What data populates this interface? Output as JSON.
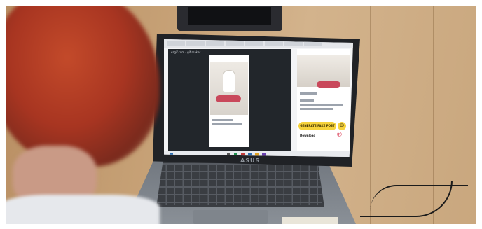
{
  "photo": {
    "description_free": true
  },
  "screen": {
    "viewer_title": "ezgif.com - gif maker",
    "generate_button": "GENERATE FAKE POST",
    "download_label": "Download"
  },
  "laptop": {
    "brand_logo": "ASUS"
  },
  "colors": {
    "hair": "#a83521",
    "button_yellow": "#f6d23b",
    "rose": "#c9485b",
    "pinterest": "#d6233f"
  }
}
